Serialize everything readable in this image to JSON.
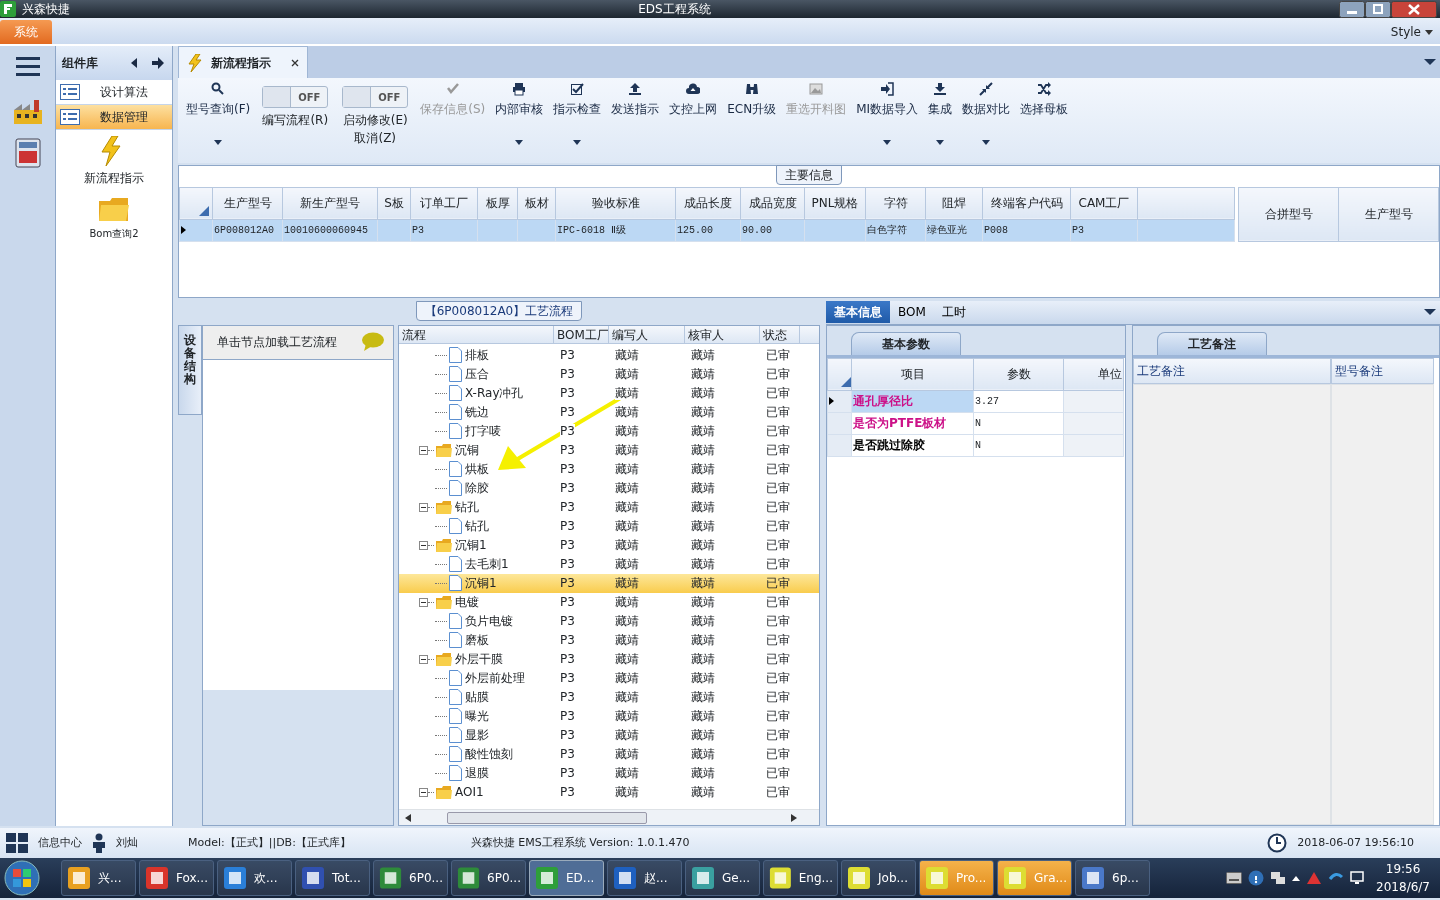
{
  "title_bar": {
    "app": "兴森快捷",
    "title": "EDS工程系统"
  },
  "menu_bar": {
    "items": [
      {
        "label": "系统",
        "selected": true
      }
    ],
    "style_label": "Style"
  },
  "component_panel": {
    "title": "组件库",
    "items": [
      {
        "label": "设计算法",
        "selected": false
      },
      {
        "label": "数据管理",
        "selected": true
      }
    ],
    "launchers": [
      {
        "label": "新流程指示",
        "kind": "bolt"
      },
      {
        "label": "Bom查询2",
        "kind": "folder"
      }
    ]
  },
  "doc_tabs": [
    {
      "label": "新流程指示",
      "selected": true
    }
  ],
  "toolbar": [
    {
      "kind": "button",
      "label": "型号查询(F)",
      "disabled": false,
      "dropdown": true
    },
    {
      "kind": "toggle",
      "label": "编写流程(R)",
      "state_text": "OFF",
      "on": false
    },
    {
      "kind": "toggle",
      "label": "启动修改(E)",
      "label2": "取消(Z)",
      "state_text": "OFF",
      "on": false
    },
    {
      "kind": "button",
      "label": "保存信息(S)",
      "disabled": true,
      "dropdown": false
    },
    {
      "kind": "button",
      "label": "内部审核",
      "disabled": false,
      "dropdown": true
    },
    {
      "kind": "button",
      "label": "指示检查",
      "disabled": false,
      "dropdown": true
    },
    {
      "kind": "button",
      "label": "发送指示",
      "disabled": false,
      "dropdown": false
    },
    {
      "kind": "button",
      "label": "文控上网",
      "disabled": false,
      "dropdown": false
    },
    {
      "kind": "button",
      "label": "ECN升级",
      "disabled": false,
      "dropdown": false
    },
    {
      "kind": "button",
      "label": "重选开料图",
      "disabled": true,
      "dropdown": false
    },
    {
      "kind": "button",
      "label": "MI数据导入",
      "disabled": false,
      "dropdown": true
    },
    {
      "kind": "button",
      "label": "集成",
      "disabled": false,
      "dropdown": true
    },
    {
      "kind": "button",
      "label": "数据对比",
      "disabled": false,
      "dropdown": true
    },
    {
      "kind": "button",
      "label": "选择母板",
      "disabled": false,
      "dropdown": false
    }
  ],
  "main_info": {
    "title": "主要信息",
    "columns": [
      "生产型号",
      "新生产型号",
      "S板",
      "订单工厂",
      "板厚",
      "板材",
      "验收标准",
      "成品长度",
      "成品宽度",
      "PNL规格",
      "字符",
      "阻焊",
      "终端客户代码",
      "CAM工厂"
    ],
    "rows": [
      {
        "selected": true,
        "cells": [
          "6P008012A0",
          "10010600060945",
          null,
          "P3",
          null,
          null,
          "IPC-6018 Ⅱ级",
          "125.00",
          "90.00",
          null,
          "白色字符",
          "绿色亚光",
          "P008",
          "P3"
        ]
      }
    ],
    "side_columns": [
      "合拼型号",
      "生产型号"
    ]
  },
  "process": {
    "title": "【6P008012A0】工艺流程",
    "side_tab": "设备结构",
    "hint": "单击节点加载工艺流程",
    "columns": [
      "流程",
      "BOM工厂",
      "编写人",
      "核审人",
      "状态"
    ],
    "continued_children": [
      {
        "name": "排板",
        "bom": "P3",
        "writer": "藏靖",
        "reviewer": "藏靖",
        "status": "已审",
        "selected": false
      },
      {
        "name": "压合",
        "bom": "P3",
        "writer": "藏靖",
        "reviewer": "藏靖",
        "status": "已审",
        "selected": false
      },
      {
        "name": "X-Ray冲孔",
        "bom": "P3",
        "writer": "藏靖",
        "reviewer": "藏靖",
        "status": "已审",
        "selected": false
      },
      {
        "name": "铣边",
        "bom": "P3",
        "writer": "藏靖",
        "reviewer": "藏靖",
        "status": "已审",
        "selected": false
      },
      {
        "name": "打字唛",
        "bom": "P3",
        "writer": "藏靖",
        "reviewer": "藏靖",
        "status": "已审",
        "selected": false
      }
    ],
    "nodes": [
      {
        "name": "沉铜",
        "bom": "P3",
        "writer": "藏靖",
        "reviewer": "藏靖",
        "status": "已审",
        "selected": false,
        "expanded": true,
        "children": [
          {
            "name": "烘板",
            "bom": "P3",
            "writer": "藏靖",
            "reviewer": "藏靖",
            "status": "已审",
            "selected": false
          },
          {
            "name": "除胶",
            "bom": "P3",
            "writer": "藏靖",
            "reviewer": "藏靖",
            "status": "已审",
            "selected": false
          }
        ]
      },
      {
        "name": "钻孔",
        "bom": "P3",
        "writer": "藏靖",
        "reviewer": "藏靖",
        "status": "已审",
        "selected": false,
        "expanded": true,
        "children": [
          {
            "name": "钻孔",
            "bom": "P3",
            "writer": "藏靖",
            "reviewer": "藏靖",
            "status": "已审",
            "selected": false
          }
        ]
      },
      {
        "name": "沉铜1",
        "bom": "P3",
        "writer": "藏靖",
        "reviewer": "藏靖",
        "status": "已审",
        "selected": false,
        "expanded": true,
        "children": [
          {
            "name": "去毛刺1",
            "bom": "P3",
            "writer": "藏靖",
            "reviewer": "藏靖",
            "status": "已审",
            "selected": false
          },
          {
            "name": "沉铜1",
            "bom": "P3",
            "writer": "藏靖",
            "reviewer": "藏靖",
            "status": "已审",
            "selected": true
          }
        ]
      },
      {
        "name": "电镀",
        "bom": "P3",
        "writer": "藏靖",
        "reviewer": "藏靖",
        "status": "已审",
        "selected": false,
        "expanded": true,
        "children": [
          {
            "name": "负片电镀",
            "bom": "P3",
            "writer": "藏靖",
            "reviewer": "藏靖",
            "status": "已审",
            "selected": false
          },
          {
            "name": "磨板",
            "bom": "P3",
            "writer": "藏靖",
            "reviewer": "藏靖",
            "status": "已审",
            "selected": false
          }
        ]
      },
      {
        "name": "外层干膜",
        "bom": "P3",
        "writer": "藏靖",
        "reviewer": "藏靖",
        "status": "已审",
        "selected": false,
        "expanded": true,
        "children": [
          {
            "name": "外层前处理",
            "bom": "P3",
            "writer": "藏靖",
            "reviewer": "藏靖",
            "status": "已审",
            "selected": false
          },
          {
            "name": "贴膜",
            "bom": "P3",
            "writer": "藏靖",
            "reviewer": "藏靖",
            "status": "已审",
            "selected": false
          },
          {
            "name": "曝光",
            "bom": "P3",
            "writer": "藏靖",
            "reviewer": "藏靖",
            "status": "已审",
            "selected": false
          },
          {
            "name": "显影",
            "bom": "P3",
            "writer": "藏靖",
            "reviewer": "藏靖",
            "status": "已审",
            "selected": false
          },
          {
            "name": "酸性蚀刻",
            "bom": "P3",
            "writer": "藏靖",
            "reviewer": "藏靖",
            "status": "已审",
            "selected": false
          },
          {
            "name": "退膜",
            "bom": "P3",
            "writer": "藏靖",
            "reviewer": "藏靖",
            "status": "已审",
            "selected": false
          }
        ]
      },
      {
        "name": "AOI1",
        "bom": "P3",
        "writer": "藏靖",
        "reviewer": "藏靖",
        "status": "已审",
        "selected": false,
        "expanded": true
      }
    ]
  },
  "detail_tabs": [
    {
      "label": "基本信息",
      "selected": true
    },
    {
      "label": "BOM",
      "selected": false
    },
    {
      "label": "工时",
      "selected": false
    }
  ],
  "basic_params": {
    "tab": "基本参数",
    "columns": [
      "项目",
      "参数",
      "单位"
    ],
    "rows": [
      {
        "item": "通孔厚径比",
        "value": "3.27",
        "color": "#cc1188",
        "selected": true
      },
      {
        "item": "是否为PTFE板材",
        "value": "N",
        "color": "#cc1188",
        "selected": false
      },
      {
        "item": "是否跳过除胶",
        "value": "N",
        "color": "#000000",
        "selected": false
      }
    ]
  },
  "remarks": {
    "tab": "工艺备注",
    "columns": [
      "工艺备注",
      "型号备注"
    ]
  },
  "status_bar": {
    "info_center": "信息中心",
    "user": "刘灿",
    "model": "Model:【正式】||DB:【正式库】",
    "version": "兴森快捷 EMS工程系统 Version: 1.0.1.470",
    "datetime": "2018-06-07 19:56:10"
  },
  "taskbar": {
    "items": [
      {
        "label": "兴...",
        "active": false,
        "highlighted": false
      },
      {
        "label": "Fox...",
        "active": false,
        "highlighted": false
      },
      {
        "label": "欢...",
        "active": false,
        "highlighted": false
      },
      {
        "label": "Tot...",
        "active": false,
        "highlighted": false
      },
      {
        "label": "6P0...",
        "active": false,
        "highlighted": false
      },
      {
        "label": "6P0...",
        "active": false,
        "highlighted": false
      },
      {
        "label": "ED...",
        "active": true,
        "highlighted": false
      },
      {
        "label": "赵...",
        "active": false,
        "highlighted": false
      },
      {
        "label": "Ge...",
        "active": false,
        "highlighted": false
      },
      {
        "label": "Eng...",
        "active": false,
        "highlighted": false
      },
      {
        "label": "Job...",
        "active": false,
        "highlighted": false
      },
      {
        "label": "Pro...",
        "active": false,
        "highlighted": true
      },
      {
        "label": "Gra...",
        "active": false,
        "highlighted": true
      },
      {
        "label": "6p...",
        "active": false,
        "highlighted": false
      }
    ],
    "time": "19:56",
    "date": "2018/6/7"
  }
}
